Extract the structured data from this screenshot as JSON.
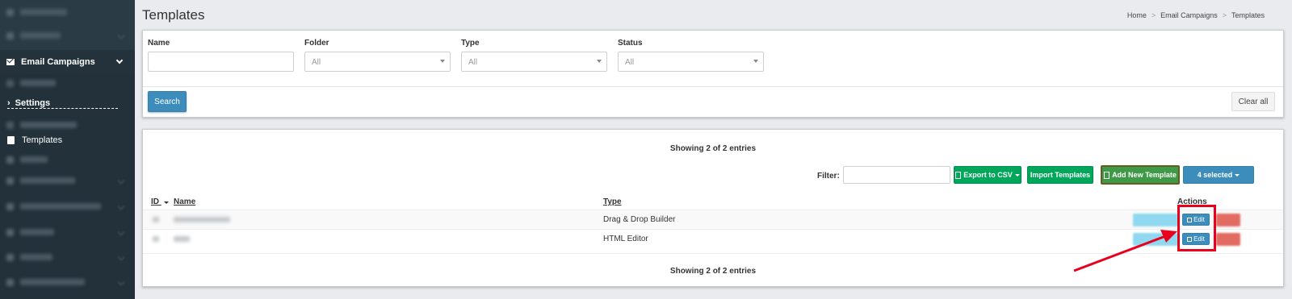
{
  "sidebar": {
    "active_section": "Email Campaigns",
    "settings_label": "Settings",
    "templates_label": "Templates"
  },
  "header": {
    "title": "Templates",
    "breadcrumb": [
      "Home",
      "Email Campaigns",
      "Templates"
    ],
    "breadcrumb_sep": ">"
  },
  "filters": {
    "name_label": "Name",
    "name_value": "",
    "folder_label": "Folder",
    "folder_value": "All",
    "type_label": "Type",
    "type_value": "All",
    "status_label": "Status",
    "status_value": "All",
    "search_label": "Search",
    "clear_label": "Clear all"
  },
  "table": {
    "showing_text": "Showing 2 of 2 entries",
    "filter_label": "Filter:",
    "filter_value": "",
    "export_label": "Export to CSV",
    "import_label": "Import Templates",
    "add_label": "Add New Template",
    "selected_label": "4 selected",
    "columns": {
      "id": "ID",
      "name": "Name",
      "type": "Type",
      "actions": "Actions"
    },
    "rows": [
      {
        "type": "Drag & Drop Builder",
        "edit_label": "Edit"
      },
      {
        "type": "HTML Editor",
        "edit_label": "Edit"
      }
    ]
  },
  "colors": {
    "sidebar_bg": "#2a3b45",
    "primary": "#3c8dbc",
    "success": "#00a65a",
    "highlight": "#e8001c"
  }
}
